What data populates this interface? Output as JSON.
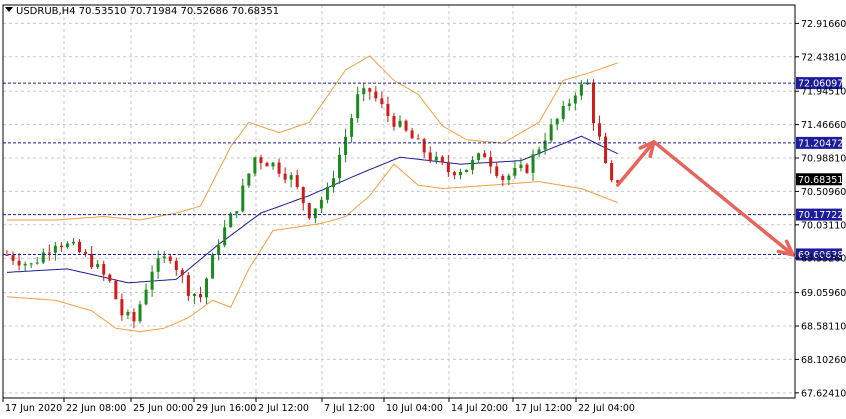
{
  "window": {
    "symbol_line": "USDRUB,H4  70.53510 70.71984 70.52686 70.68351",
    "collapse_icon": "triangle-down-icon"
  },
  "colors": {
    "background": "#ffffff",
    "grid": "#c8c8c8",
    "candle_bull": "#1a8a1a",
    "candle_bear": "#d11a1a",
    "bollinger": "#f0a040",
    "moving_average": "#1c1c9c",
    "level_line": "#1c1c9c",
    "level_label_bg": "#1c1c9c",
    "level_label_text": "#ffffff",
    "arrow": "#e8645a",
    "price_label_bg": "#000000",
    "price_label_text": "#ffffff"
  },
  "chart_data": {
    "type": "candlestick",
    "title": "",
    "xlabel": "",
    "ylabel": "",
    "ylim": [
      67.55,
      73.18
    ],
    "y_ticks": [
      "72.91660",
      "72.43810",
      "71.94510",
      "71.46660",
      "70.98810",
      "70.50960",
      "70.03110",
      "69.55260",
      "69.05960",
      "68.58110",
      "68.10260",
      "67.62410"
    ],
    "x_ticks": [
      "17 Jun 2020",
      "22 Jun 08:00",
      "25 Jun 00:00",
      "29 Jun 16:00",
      "2 Jul 12:00",
      "7 Jul 12:00",
      "10 Jul 04:00",
      "14 Jul 20:00",
      "17 Jul 12:00",
      "22 Jul 04:00"
    ],
    "current_price": "70.68351",
    "levels": [
      {
        "value": 72.06097,
        "label": "72.06097"
      },
      {
        "value": 71.20472,
        "label": "71.20472"
      },
      {
        "value": 70.17722,
        "label": "70.17722"
      },
      {
        "value": 69.60638,
        "label": "69.60638"
      }
    ],
    "close_path": [
      [
        0,
        69.6
      ],
      [
        4,
        69.45
      ],
      [
        8,
        69.8
      ],
      [
        11,
        69.7
      ],
      [
        14,
        69.5
      ],
      [
        17,
        69.2
      ],
      [
        19,
        68.75
      ],
      [
        21,
        68.65
      ],
      [
        24,
        69.4
      ],
      [
        27,
        69.6
      ],
      [
        30,
        69.1
      ],
      [
        32,
        69.0
      ],
      [
        35,
        69.8
      ],
      [
        38,
        70.3
      ],
      [
        41,
        71.0
      ],
      [
        44,
        70.9
      ],
      [
        47,
        70.7
      ],
      [
        50,
        70.2
      ],
      [
        53,
        70.5
      ],
      [
        56,
        71.3
      ],
      [
        58,
        71.85
      ],
      [
        60,
        71.95
      ],
      [
        63,
        71.6
      ],
      [
        66,
        71.35
      ],
      [
        70,
        71.0
      ],
      [
        73,
        70.8
      ],
      [
        76,
        70.85
      ],
      [
        79,
        71.05
      ],
      [
        82,
        70.7
      ],
      [
        86,
        70.85
      ],
      [
        89,
        71.3
      ],
      [
        92,
        71.65
      ],
      [
        94,
        71.95
      ],
      [
        96,
        72.05
      ],
      [
        97,
        71.55
      ],
      [
        98,
        71.25
      ],
      [
        99,
        70.85
      ],
      [
        100,
        70.6
      ],
      [
        101,
        70.68
      ]
    ],
    "bands": {
      "ma": [
        [
          0,
          69.35
        ],
        [
          10,
          69.4
        ],
        [
          20,
          69.2
        ],
        [
          28,
          69.25
        ],
        [
          35,
          69.75
        ],
        [
          42,
          70.2
        ],
        [
          50,
          70.45
        ],
        [
          58,
          70.75
        ],
        [
          65,
          71.0
        ],
        [
          75,
          70.9
        ],
        [
          85,
          70.95
        ],
        [
          95,
          71.3
        ],
        [
          101,
          71.05
        ]
      ],
      "upper": [
        [
          0,
          70.1
        ],
        [
          8,
          70.1
        ],
        [
          16,
          70.15
        ],
        [
          22,
          70.1
        ],
        [
          28,
          70.2
        ],
        [
          32,
          70.3
        ],
        [
          37,
          71.15
        ],
        [
          40,
          71.5
        ],
        [
          45,
          71.35
        ],
        [
          50,
          71.5
        ],
        [
          56,
          72.25
        ],
        [
          60,
          72.45
        ],
        [
          64,
          72.1
        ],
        [
          68,
          71.9
        ],
        [
          72,
          71.45
        ],
        [
          76,
          71.25
        ],
        [
          82,
          71.2
        ],
        [
          88,
          71.5
        ],
        [
          92,
          72.1
        ],
        [
          96,
          72.2
        ],
        [
          101,
          72.35
        ]
      ],
      "lower": [
        [
          0,
          69.0
        ],
        [
          8,
          68.95
        ],
        [
          14,
          68.8
        ],
        [
          18,
          68.55
        ],
        [
          22,
          68.5
        ],
        [
          26,
          68.55
        ],
        [
          30,
          68.7
        ],
        [
          34,
          68.95
        ],
        [
          37,
          68.85
        ],
        [
          40,
          69.4
        ],
        [
          44,
          69.95
        ],
        [
          48,
          70.0
        ],
        [
          52,
          70.05
        ],
        [
          56,
          70.15
        ],
        [
          60,
          70.45
        ],
        [
          64,
          70.9
        ],
        [
          68,
          70.6
        ],
        [
          72,
          70.55
        ],
        [
          80,
          70.6
        ],
        [
          88,
          70.65
        ],
        [
          95,
          70.55
        ],
        [
          101,
          70.35
        ]
      ]
    },
    "forecast_arrows": [
      {
        "from": [
          101,
          70.6
        ],
        "to": [
          107,
          71.22
        ]
      },
      {
        "from": [
          107,
          71.22
        ],
        "to": [
          130,
          69.6
        ]
      }
    ]
  }
}
